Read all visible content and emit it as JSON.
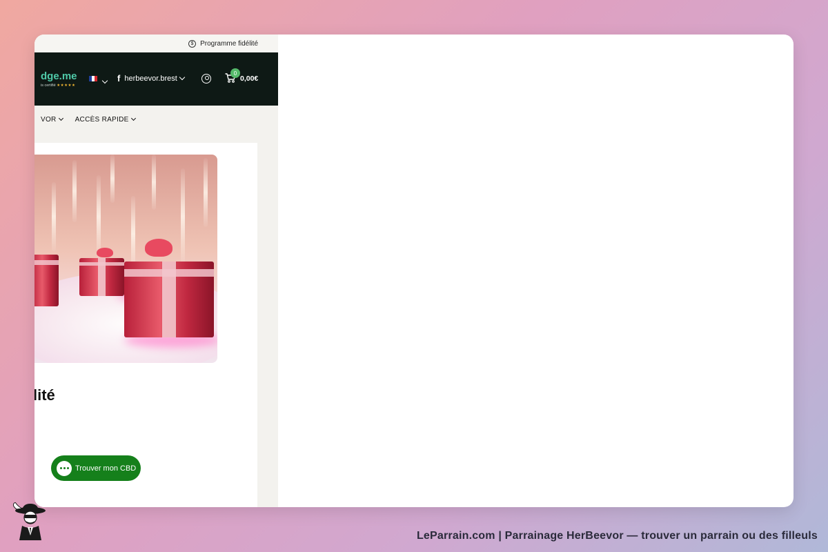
{
  "topbar": {
    "loyalty_label": "Programme fidélité",
    "coin_symbol": "$"
  },
  "header": {
    "logo_text": "dge.me",
    "logo_subtext": "is certifié",
    "logo_stars": "★★★★★",
    "language": "fr",
    "social_handle": "herbeevor.brest",
    "cart_count": "0",
    "cart_total": "0,00€"
  },
  "nav": {
    "items": [
      {
        "label": "VOR"
      },
      {
        "label": "ACCÈS RAPIDE"
      }
    ]
  },
  "main": {
    "title": "lité"
  },
  "chat": {
    "label": "Trouver mon CBD"
  },
  "footer": {
    "caption": "LeParrain.com | Parrainage HerBeevor — trouver un parrain ou des filleuls"
  },
  "colors": {
    "header_bg": "#0e1915",
    "logo": "#4fc9a8",
    "badge": "#55b96a",
    "chat_button": "#15801b"
  }
}
